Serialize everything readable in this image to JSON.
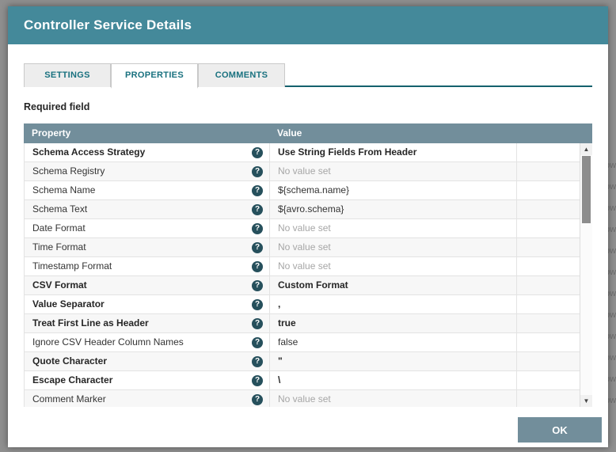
{
  "dialog": {
    "title": "Controller Service Details",
    "tabs": [
      {
        "label": "SETTINGS",
        "active": false
      },
      {
        "label": "PROPERTIES",
        "active": true
      },
      {
        "label": "COMMENTS",
        "active": false
      }
    ],
    "required_field_label": "Required field",
    "help_icon_glyph": "?",
    "table": {
      "columns": [
        "Property",
        "Value"
      ],
      "rows": [
        {
          "property": "Schema Access Strategy",
          "value": "Use String Fields From Header",
          "required": true,
          "value_set": true
        },
        {
          "property": "Schema Registry",
          "value": "No value set",
          "required": false,
          "value_set": false
        },
        {
          "property": "Schema Name",
          "value": "${schema.name}",
          "required": false,
          "value_set": true
        },
        {
          "property": "Schema Text",
          "value": "${avro.schema}",
          "required": false,
          "value_set": true
        },
        {
          "property": "Date Format",
          "value": "No value set",
          "required": false,
          "value_set": false
        },
        {
          "property": "Time Format",
          "value": "No value set",
          "required": false,
          "value_set": false
        },
        {
          "property": "Timestamp Format",
          "value": "No value set",
          "required": false,
          "value_set": false
        },
        {
          "property": "CSV Format",
          "value": "Custom Format",
          "required": true,
          "value_set": true
        },
        {
          "property": "Value Separator",
          "value": ",",
          "required": true,
          "value_set": true
        },
        {
          "property": "Treat First Line as Header",
          "value": "true",
          "required": true,
          "value_set": true
        },
        {
          "property": "Ignore CSV Header Column Names",
          "value": "false",
          "required": false,
          "value_set": true
        },
        {
          "property": "Quote Character",
          "value": "\"",
          "required": true,
          "value_set": true
        },
        {
          "property": "Escape Character",
          "value": "\\",
          "required": true,
          "value_set": true
        },
        {
          "property": "Comment Marker",
          "value": "No value set",
          "required": false,
          "value_set": false
        }
      ]
    },
    "scrollbar": {
      "up_glyph": "▲",
      "down_glyph": "▼"
    },
    "ok_button": "OK"
  },
  "colors": {
    "header_teal": "#44899A",
    "table_header_slate": "#728E9B",
    "tab_underline_teal": "#14616D",
    "tab_text_teal": "#19717F",
    "help_icon_bg": "#26505C",
    "ok_button_bg": "#728E9B",
    "no_value_gray": "#A6A6A6",
    "overlay_gray": "#8F8F8F"
  },
  "background_fragments": [
    "ow",
    "ow",
    "ow",
    "ow",
    "ow",
    "ow",
    "ow",
    "ow",
    "ow",
    "ow",
    "ow",
    "ow"
  ]
}
